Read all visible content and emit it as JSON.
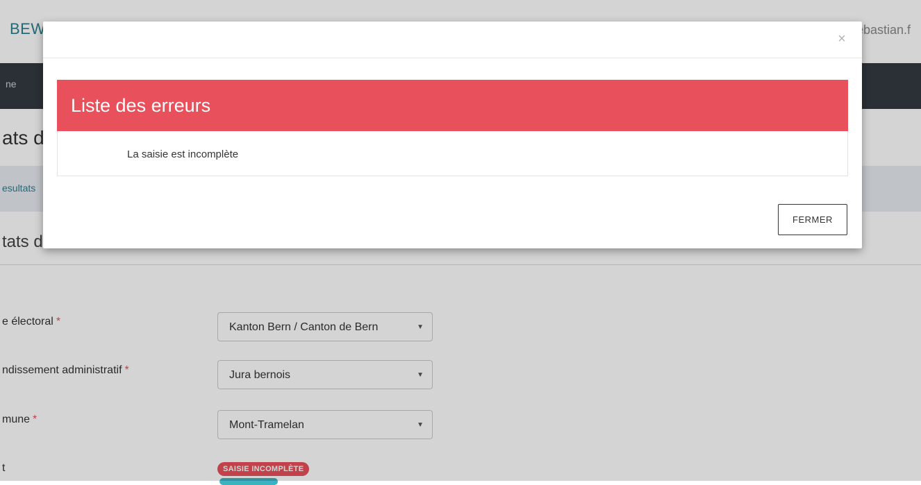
{
  "header": {
    "brand": "BEW",
    "user": "ebastian.f"
  },
  "nav": {
    "items": [
      {
        "label": "ne"
      }
    ]
  },
  "page": {
    "title": "ats d",
    "breadcrumb": "esultats",
    "section_title": "tats d"
  },
  "form": {
    "fields": [
      {
        "label": "e électoral",
        "required_mark": "*",
        "value": "Kanton Bern / Canton de Bern"
      },
      {
        "label": "ndissement administratif",
        "required_mark": "*",
        "value": "Jura bernois"
      },
      {
        "label": "mune",
        "required_mark": "*",
        "value": "Mont-Tramelan"
      }
    ],
    "status_label": "t",
    "status_badge": "SAISIE INCOMPLÈTE"
  },
  "modal": {
    "close_icon": "×",
    "error_title": "Liste des erreurs",
    "error_message": "La saisie est incomplète",
    "close_button": "FERMER"
  },
  "colors": {
    "error_red": "#e8505b",
    "nav_dark": "#333a41",
    "brand_teal": "#2a7f8e",
    "breadcrumb_bg": "#e7ebf1"
  }
}
